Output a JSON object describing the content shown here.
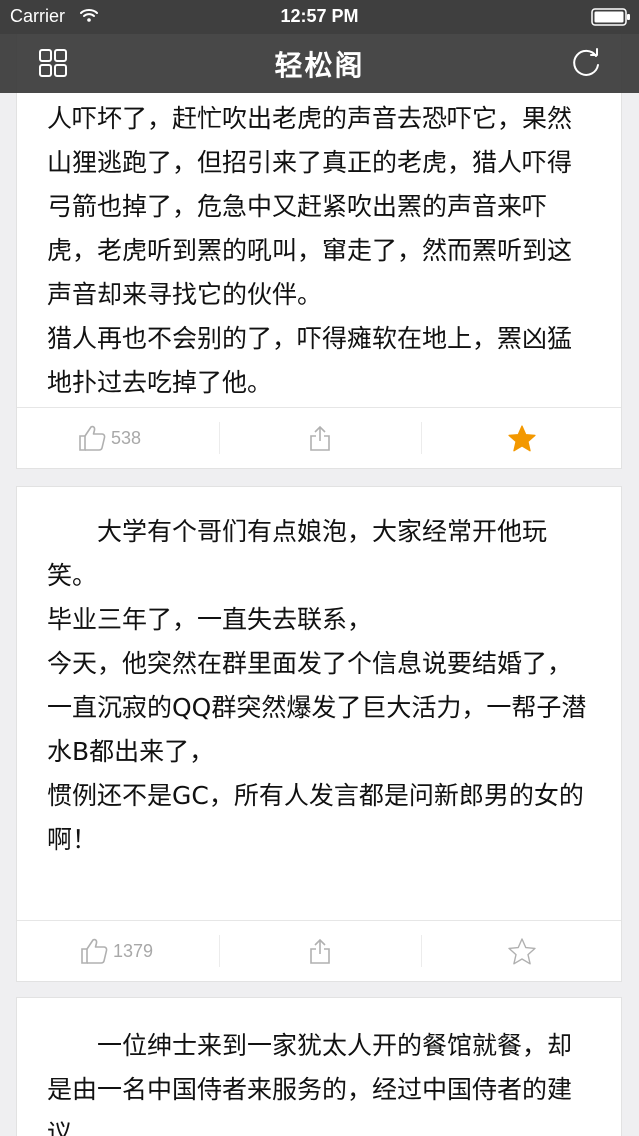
{
  "status_bar": {
    "carrier": "Carrier",
    "time": "12:57 PM"
  },
  "nav": {
    "title": "轻松阁",
    "left_icon": "grid-icon",
    "right_icon": "refresh-icon"
  },
  "colors": {
    "nav_background": "#3a3a3a",
    "favorite_active": "#f39800",
    "icon_gray": "#b0b0b0",
    "text": "#111111"
  },
  "posts": [
    {
      "text": "人吓坏了，赶忙吹出老虎的声音去恐吓它，果然山狸逃跑了，但招引来了真正的老虎，猎人吓得弓箭也掉了，危急中又赶紧吹出罴的声音来吓虎，老虎听到罴的吼叫，窜走了，然而罴听到这声音却来寻找它的伙伴。\n猎人再也不会别的了，吓得瘫软在地上，罴凶猛地扑过去吃掉了他。",
      "likes": "538",
      "favorited": true
    },
    {
      "text": "　　大学有个哥们有点娘泡，大家经常开他玩笑。\n毕业三年了，一直失去联系，\n今天，他突然在群里面发了个信息说要结婚了，\n一直沉寂的QQ群突然爆发了巨大活力，一帮子潜水B都出来了，\n惯例还不是GC，所有人发言都是问新郎男的女的啊！",
      "likes": "1379",
      "favorited": false
    },
    {
      "text": "　　一位绅士来到一家犹太人开的餐馆就餐，却是由一名中国侍者来服务的，经过中国侍者的建议",
      "likes": "",
      "favorited": false
    }
  ]
}
